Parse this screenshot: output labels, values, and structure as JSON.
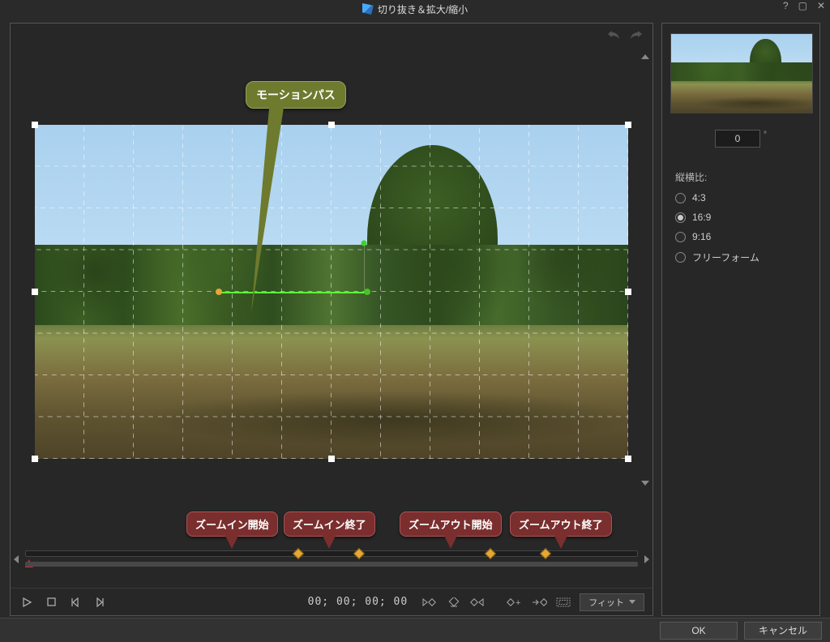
{
  "window": {
    "title": "切り抜き＆拡大/縮小"
  },
  "callouts": {
    "motion_path": "モーションパス",
    "zoom_in_start": "ズームイン開始",
    "zoom_in_end": "ズームイン終了",
    "zoom_out_start": "ズームアウト開始",
    "zoom_out_end": "ズームアウト終了"
  },
  "timeline": {
    "keyframe_positions_pct": [
      44.5,
      54.5,
      76,
      85
    ],
    "playhead_pct": 0
  },
  "playback": {
    "timecode": "00; 00; 00; 00",
    "fit_label": "フィット"
  },
  "side": {
    "rotation_value": "0",
    "aspect_label": "縦横比:",
    "ratios": [
      {
        "label": "4:3",
        "selected": false
      },
      {
        "label": "16:9",
        "selected": true
      },
      {
        "label": "9:16",
        "selected": false
      },
      {
        "label": "フリーフォーム",
        "selected": false
      }
    ]
  },
  "footer": {
    "ok": "OK",
    "cancel": "キャンセル"
  }
}
